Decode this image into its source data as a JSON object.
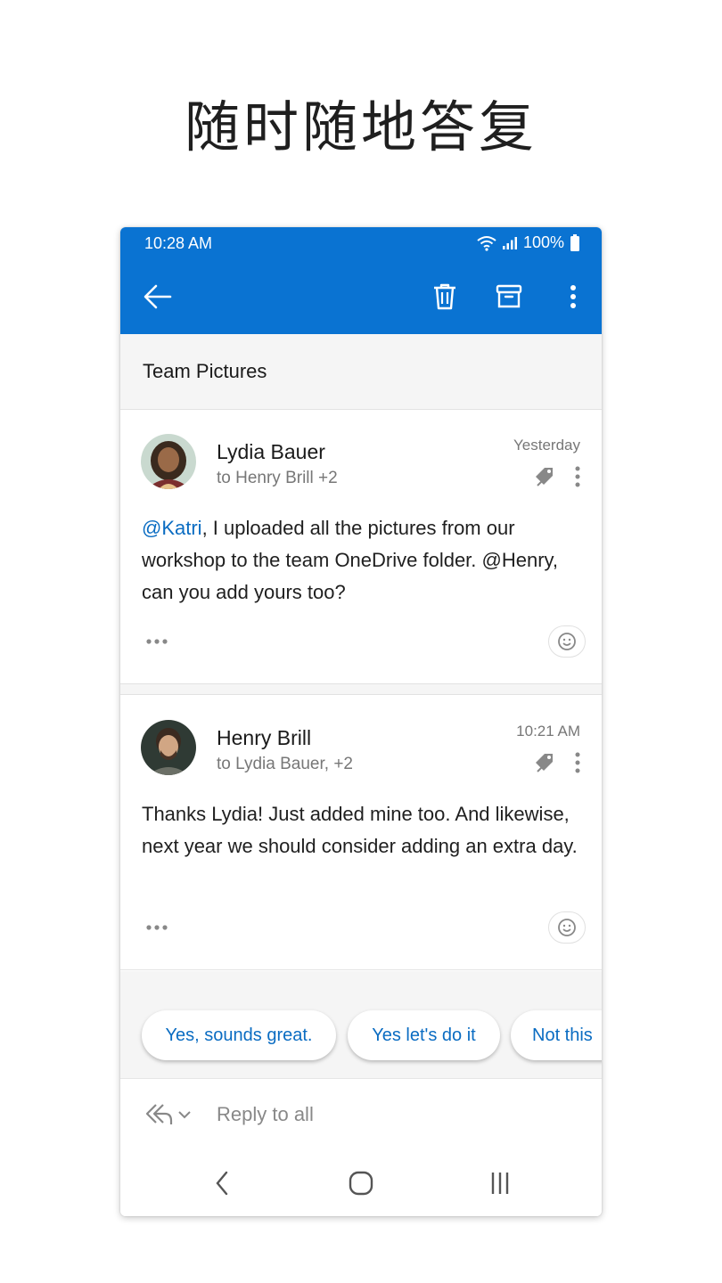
{
  "headline": "随时随地答复",
  "status_bar": {
    "time": "10:28 AM",
    "battery": "100%"
  },
  "toolbar": {
    "icons": [
      "back-arrow-icon",
      "trash-icon",
      "archive-icon",
      "more-vertical-icon"
    ]
  },
  "thread": {
    "subject": "Team Pictures"
  },
  "messages": [
    {
      "sender": "Lydia Bauer",
      "recipients": "to Henry Brill +2",
      "timestamp": "Yesterday",
      "mention": "@Katri",
      "body": ", I uploaded all the pictures from our workshop to the team OneDrive folder. @Henry, can you add yours too?"
    },
    {
      "sender": "Henry Brill",
      "recipients": "to Lydia Bauer, +2",
      "timestamp": "10:21 AM",
      "mention": "",
      "body": "Thanks Lydia! Just added mine too. And likewise, next year we should consider adding an extra day."
    }
  ],
  "quick_replies": [
    "Yes, sounds great.",
    "Yes let's do it",
    "Not this"
  ],
  "reply_bar": {
    "label": "Reply to all"
  },
  "colors": {
    "accent": "#0a73d2",
    "link": "#0a6cc2",
    "surface": "#f5f5f5"
  }
}
